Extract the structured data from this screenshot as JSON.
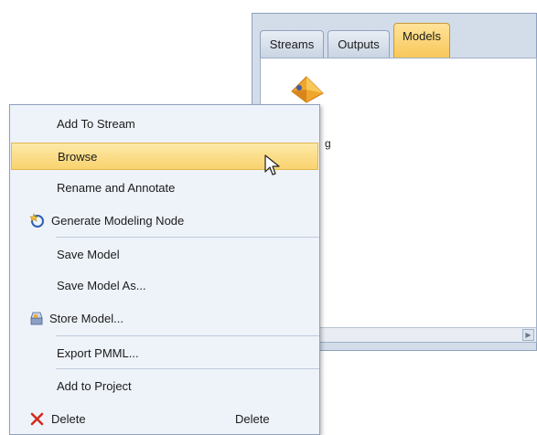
{
  "tabs": [
    "Streams",
    "Outputs",
    "Models"
  ],
  "active_tab": "Models",
  "node_label": "g",
  "menu": {
    "items": [
      {
        "label": "Add To Stream"
      },
      {
        "label": "Browse",
        "highlighted": true
      },
      {
        "label": "Rename and Annotate"
      },
      {
        "label": "Generate Modeling Node",
        "icon": "generate-wand-icon"
      },
      {
        "label": "Save Model"
      },
      {
        "label": "Save Model As..."
      },
      {
        "label": "Store Model...",
        "icon": "store-model-icon"
      },
      {
        "label": "Export PMML..."
      },
      {
        "label": "Add to Project"
      },
      {
        "label": "Delete",
        "shortcut": "Delete",
        "icon": "delete-x-icon"
      }
    ]
  },
  "colors": {
    "highlight": "#f9d36e",
    "active_tab": "#f8c75a",
    "menu_bg": "#eef3fa",
    "delete_red": "#d42a1e"
  }
}
